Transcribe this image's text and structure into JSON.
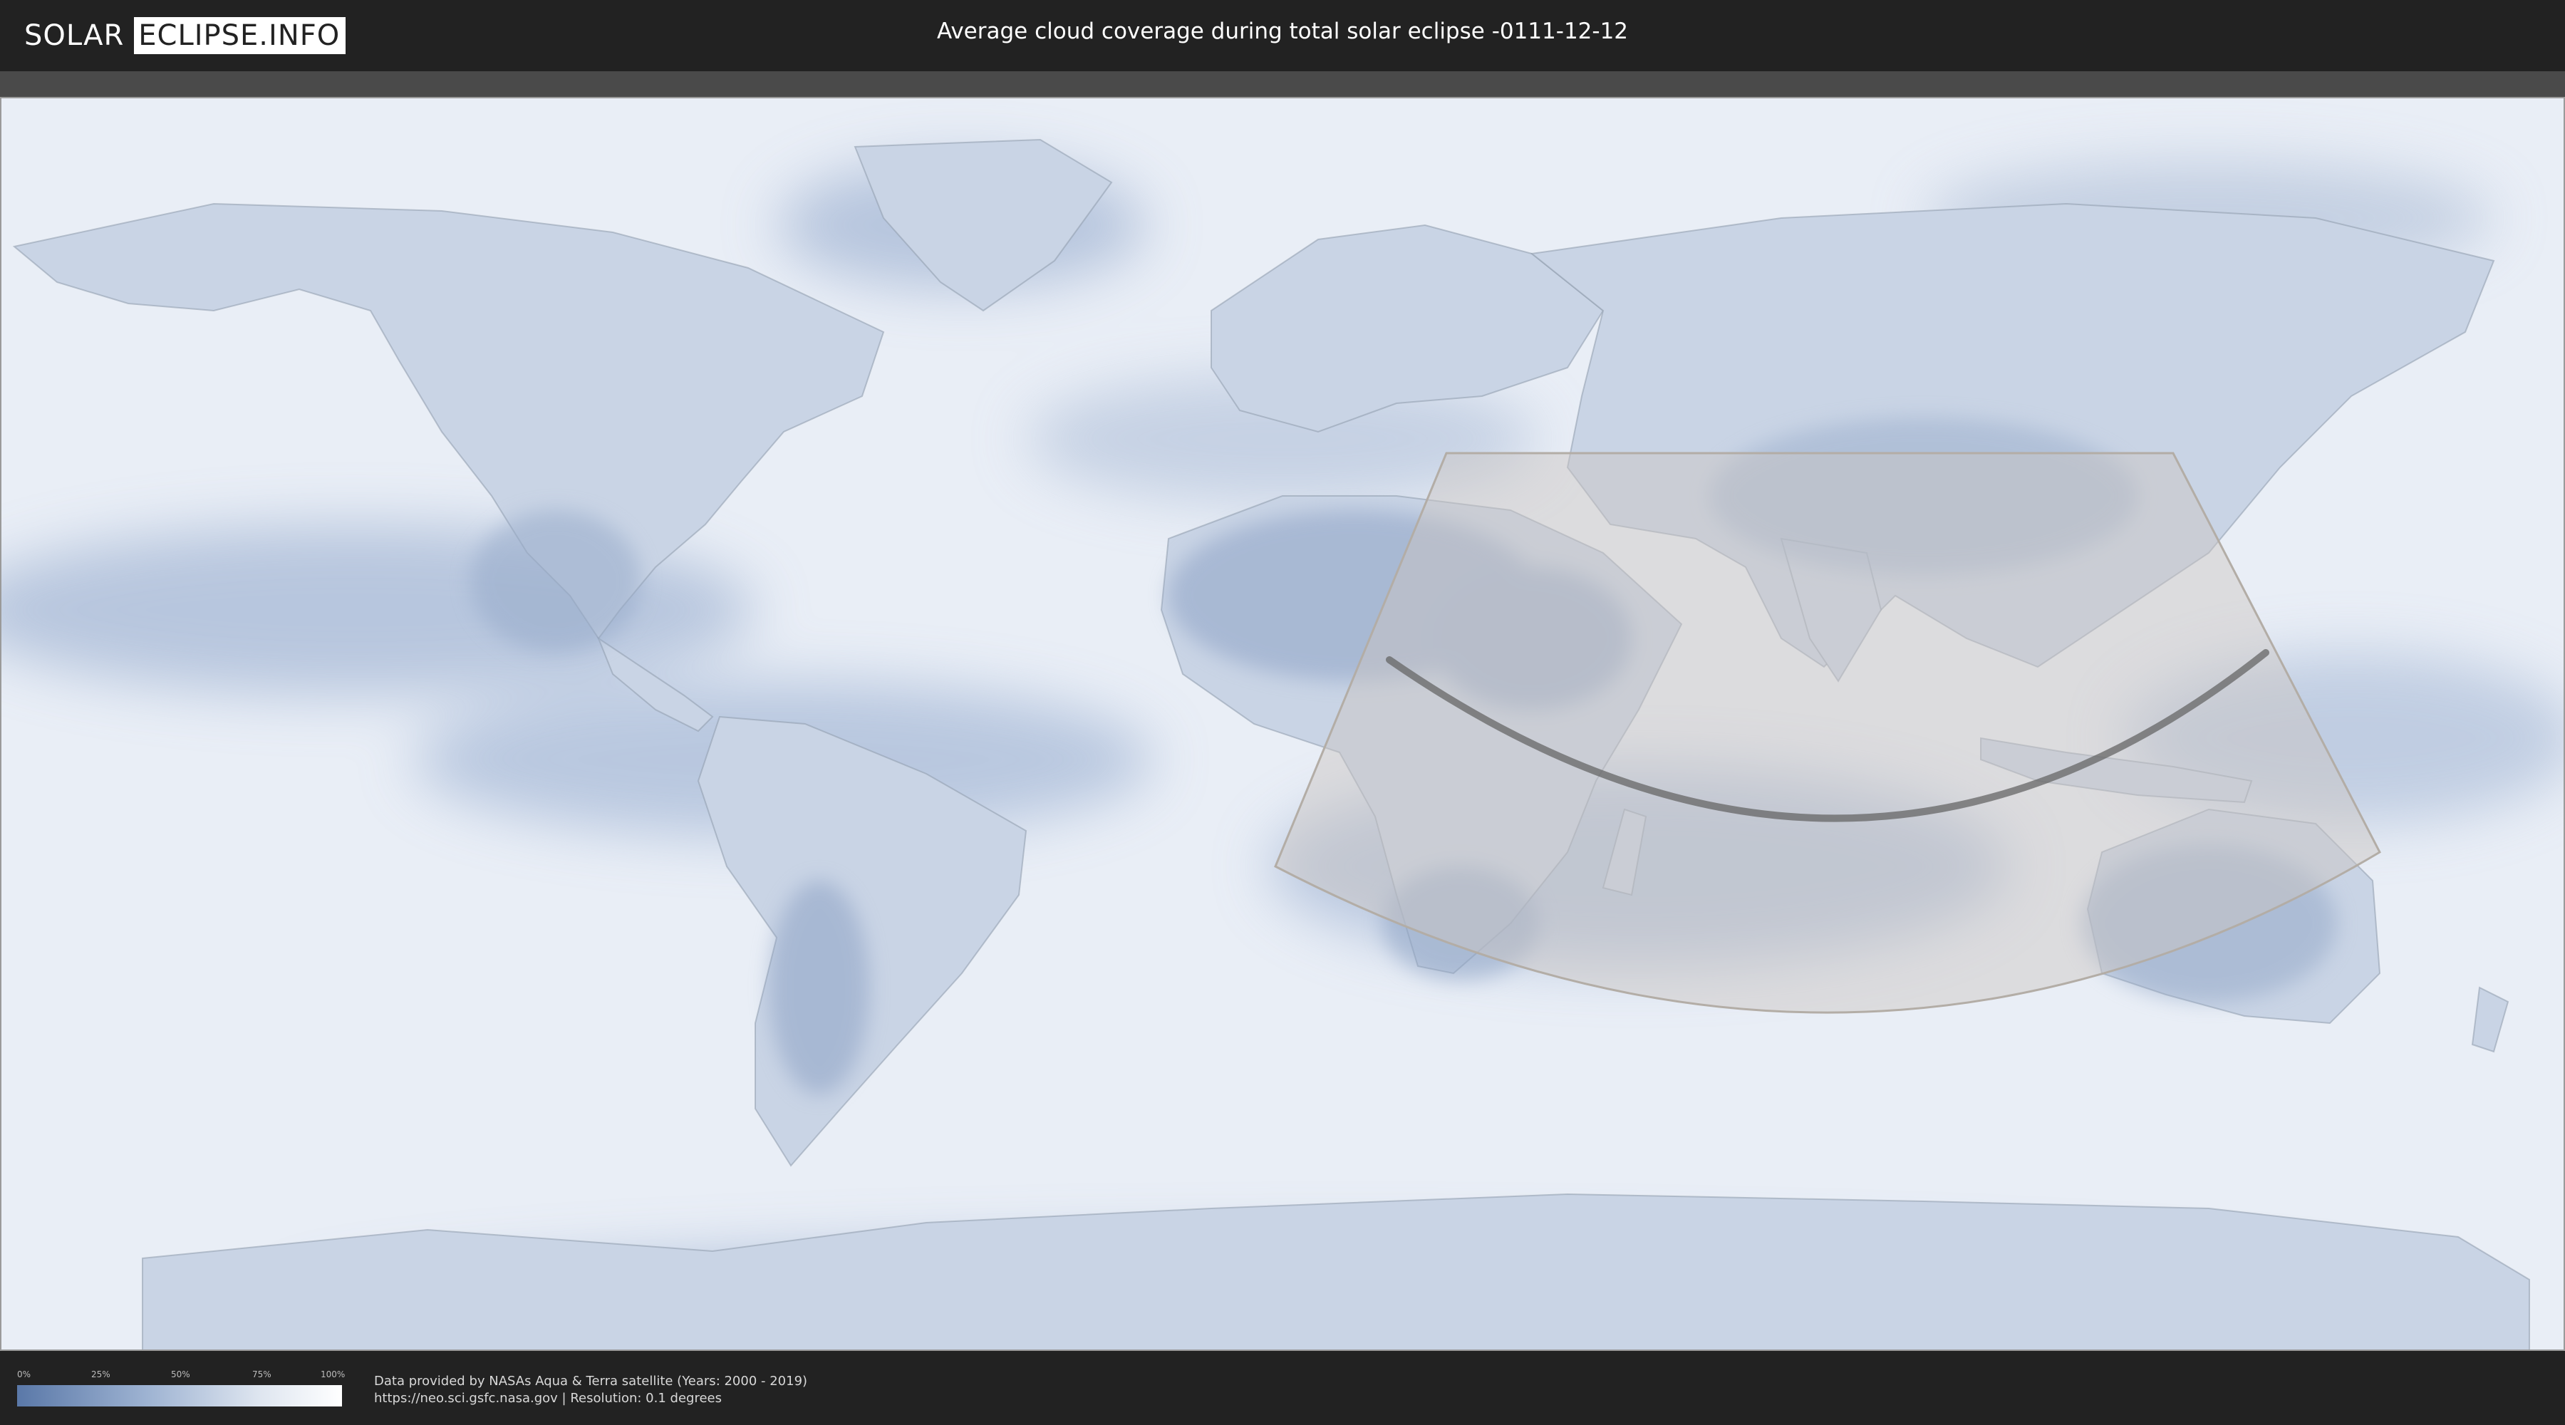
{
  "header": {
    "logo_left": "SOLAR",
    "logo_right": "ECLIPSE.INFO",
    "title": "Average cloud coverage during total solar eclipse -0111-12-12"
  },
  "legend": {
    "ticks": [
      "0%",
      "25%",
      "50%",
      "75%",
      "100%"
    ],
    "colors": {
      "low": "#5a78a8",
      "high": "#ffffff"
    }
  },
  "footer": {
    "line1": "Data provided by NASAs Aqua & Terra satellite (Years: 2000 - 2019)",
    "line2": "https://neo.sci.gsfc.nasa.gov | Resolution: 0.1 degrees"
  },
  "map": {
    "projection": "equirectangular",
    "ocean_color": "#eef2f8",
    "land_color": "#cdd7e6",
    "cloud_low_color": "#6f8cb8",
    "visibility_zone_color": "#c8c4c0",
    "central_line_color": "#666666"
  }
}
